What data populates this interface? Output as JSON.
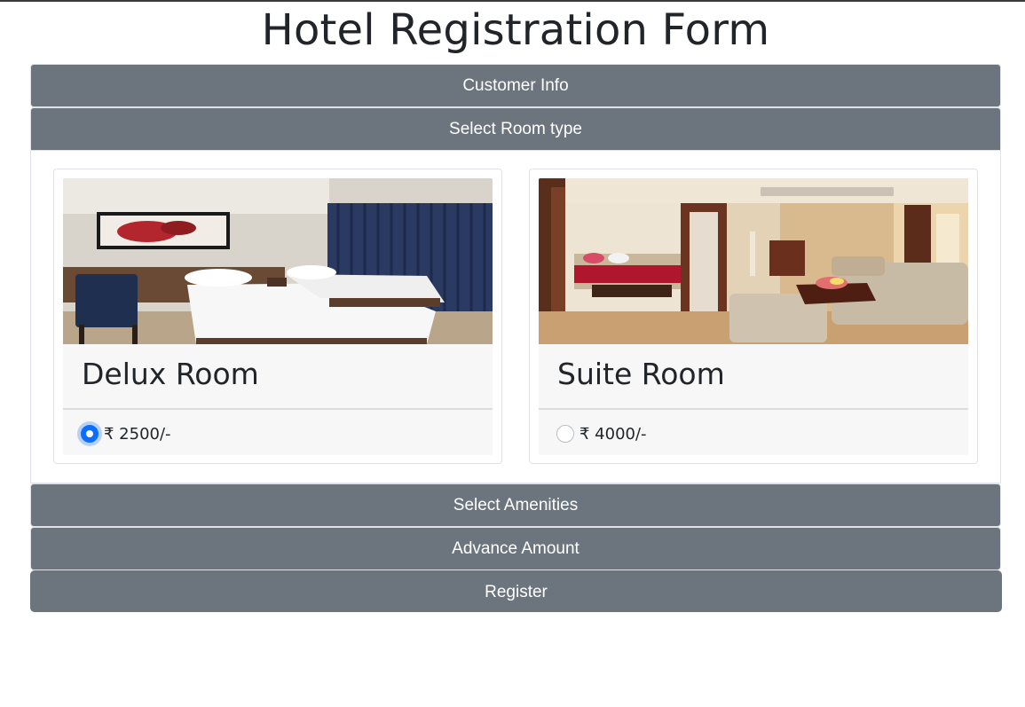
{
  "page": {
    "title": "Hotel Registration Form"
  },
  "accordion": {
    "sections": [
      {
        "label": "Customer Info",
        "open": false
      },
      {
        "label": "Select Room type",
        "open": true
      },
      {
        "label": "Select Amenities",
        "open": false
      },
      {
        "label": "Advance Amount",
        "open": false
      }
    ]
  },
  "rooms": [
    {
      "name": "Delux Room",
      "price": "₹ 2500/-",
      "selected": true
    },
    {
      "name": "Suite Room",
      "price": "₹ 4000/-",
      "selected": false
    }
  ],
  "register": {
    "label": "Register"
  },
  "colors": {
    "header_bg": "#6c757d",
    "radio_accent": "#0d6efd",
    "card_body_bg": "#f7f7f7"
  }
}
